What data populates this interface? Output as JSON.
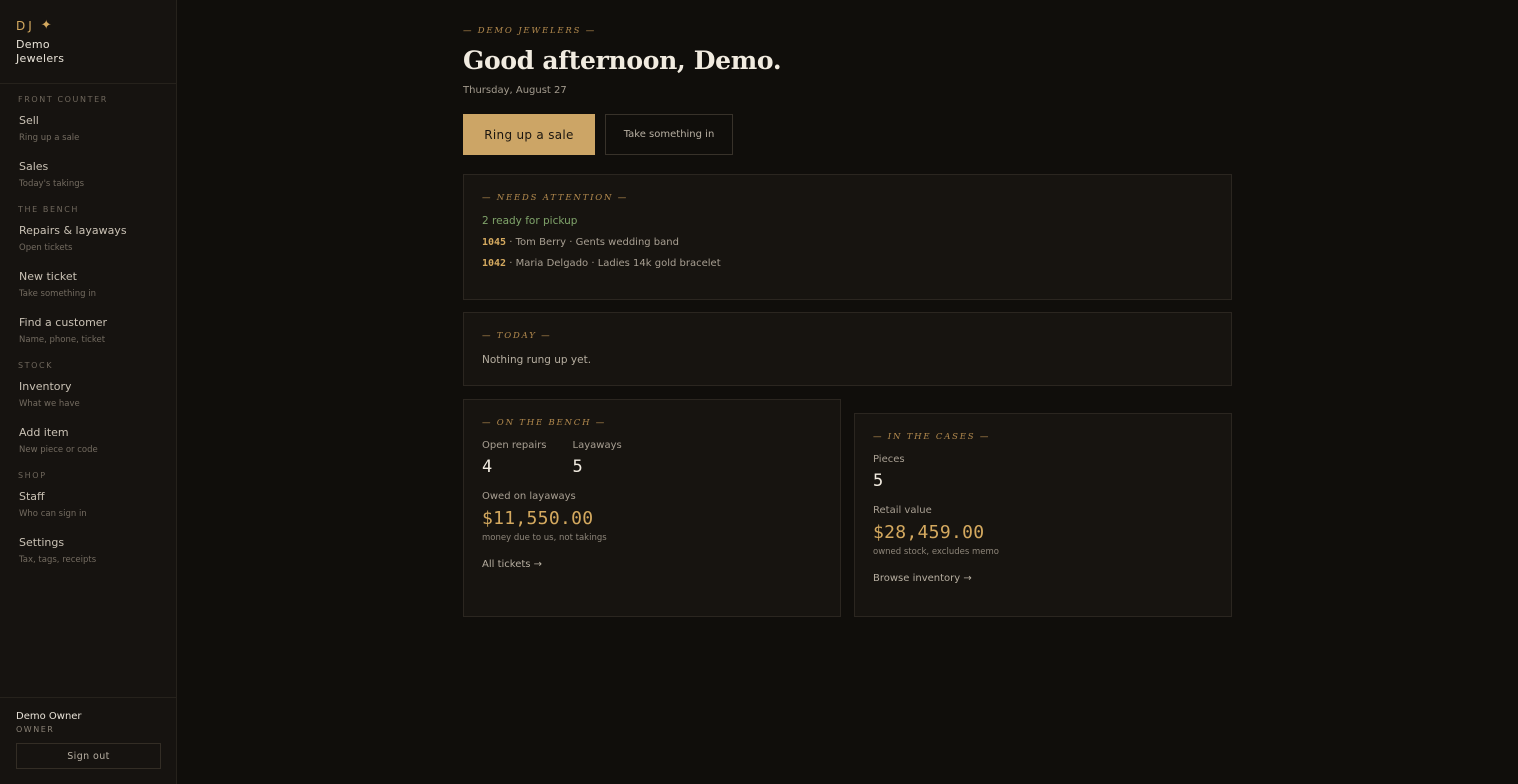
{
  "brand": {
    "mark": "DJ",
    "name_line1": "Demo",
    "name_line2": "Jewelers"
  },
  "nav": {
    "sections": [
      {
        "title": "FRONT COUNTER",
        "items": [
          {
            "label": "Sell",
            "sub": "Ring up a sale"
          },
          {
            "label": "Sales",
            "sub": "Today's takings"
          }
        ]
      },
      {
        "title": "THE BENCH",
        "items": [
          {
            "label": "Repairs & layaways",
            "sub": "Open tickets"
          },
          {
            "label": "New ticket",
            "sub": "Take something in"
          },
          {
            "label": "Find a customer",
            "sub": "Name, phone, ticket"
          }
        ]
      },
      {
        "title": "STOCK",
        "items": [
          {
            "label": "Inventory",
            "sub": "What we have"
          },
          {
            "label": "Add item",
            "sub": "New piece or code"
          }
        ]
      },
      {
        "title": "SHOP",
        "items": [
          {
            "label": "Staff",
            "sub": "Who can sign in"
          },
          {
            "label": "Settings",
            "sub": "Tax, tags, receipts"
          }
        ]
      }
    ]
  },
  "user": {
    "name": "Demo Owner",
    "role": "OWNER",
    "signout": "Sign out"
  },
  "header": {
    "eyebrow": "— DEMO JEWELERS —",
    "greeting": "Good afternoon, Demo.",
    "date": "Thursday, August 27"
  },
  "actions": {
    "primary": "Ring up a sale",
    "secondary": "Take something in"
  },
  "attention": {
    "title": "— NEEDS ATTENTION —",
    "ready": "2 ready for pickup",
    "tickets": [
      {
        "id": "1045",
        "text": " · Tom Berry · Gents wedding band"
      },
      {
        "id": "1042",
        "text": " · Maria Delgado · Ladies 14k gold bracelet"
      }
    ]
  },
  "today": {
    "title": "— TODAY —",
    "text": "Nothing rung up yet."
  },
  "bench": {
    "title": "— ON THE BENCH —",
    "open_repairs_label": "Open repairs",
    "open_repairs": "4",
    "layaways_label": "Layaways",
    "layaways": "5",
    "owed_label": "Owed on layaways",
    "owed": "$11,550.00",
    "owed_note": "money due to us, not takings",
    "link": "All tickets →"
  },
  "cases": {
    "title": "— IN THE CASES —",
    "pieces_label": "Pieces",
    "pieces": "5",
    "retail_label": "Retail value",
    "retail": "$28,459.00",
    "retail_note": "owned stock, excludes memo",
    "link": "Browse inventory →"
  },
  "colors": {
    "accent": "#cca566",
    "gold_text": "#d4a95f",
    "ready_green": "#7fa36a",
    "background": "#100e0b"
  }
}
